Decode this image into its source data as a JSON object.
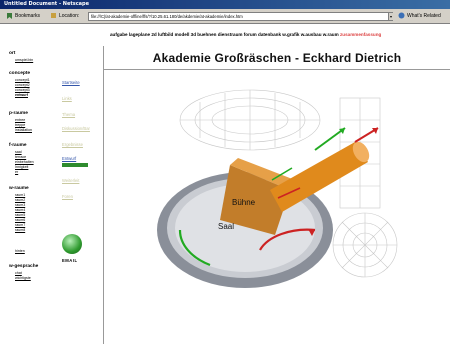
{
  "browser": {
    "title": "Untitled Document - Netscape",
    "bookmarks_label": "Bookmarks",
    "location_label": "Location:",
    "url": "file:///C|/at-akademie-offline/ffs/?/10.25.61.180/de/akdemie/at-akademie/index.htm",
    "whats_related": "What's Related"
  },
  "topnav": {
    "items": "aufgabe lageplane 2d luftbild modell 3d buehnen dienstraum forum datenbank w.grafik w.ausbau w.raum",
    "highlight": "zusammenfassung"
  },
  "page": {
    "title": "Akademie Großräschen - Eckhard Dietrich"
  },
  "sidebar": {
    "s1_title": "ort",
    "s1_items": [
      "umspiel.bin"
    ],
    "s2_title": "concepte",
    "s2_items": [
      "concept1",
      "concept2",
      "concept3",
      "entwurf"
    ],
    "s3_title": "p-raume",
    "s3_items": [
      "entree",
      "treppe",
      "installation"
    ],
    "s4_title": "f-raume",
    "s4_items": [
      "saal",
      "terrace",
      "einbehalten",
      "Innigkeit",
      "er"
    ],
    "s5_title": "w-raume",
    "s5_items": [
      "raum1",
      "raum2",
      "raum3",
      "raum4",
      "raum5",
      "raum6",
      "raum7",
      "raum8"
    ],
    "s5_extra": "hinten",
    "s6_title": "w-gesprache",
    "s6_items": [
      "chat",
      "wichtigste"
    ]
  },
  "midcol": {
    "links": [
      "Startseite",
      "Links",
      "Thema",
      "Diskussion/Bar",
      "Ergebnisse",
      "Entwurf",
      "Weiterleit",
      "Foren"
    ],
    "email_label": "EMAIL",
    "email_icon": "globe-icon"
  },
  "scene": {
    "label_buehne": "Bühne",
    "label_saal": "Saal"
  },
  "colors": {
    "accent_green": "#2e8b2e",
    "highlight_red": "#d44444",
    "tube_orange": "#e08a1c"
  }
}
